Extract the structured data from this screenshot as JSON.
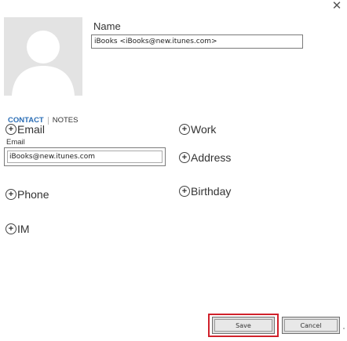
{
  "window": {
    "close_glyph": "✕"
  },
  "contact": {
    "name_label": "Name",
    "name_value": "iBooks <iBooks@new.itunes.com>"
  },
  "tabs": {
    "contact": "CONTACT",
    "notes": "NOTES"
  },
  "fields": {
    "email": {
      "label": "Email",
      "sub_label": "Email",
      "value": "iBooks@new.itunes.com"
    },
    "work": {
      "label": "Work"
    },
    "address": {
      "label": "Address"
    },
    "phone": {
      "label": "Phone"
    },
    "birthday": {
      "label": "Birthday"
    },
    "im": {
      "label": "IM"
    }
  },
  "plus_glyph": "+",
  "buttons": {
    "save": "Save",
    "cancel": "Cancel"
  },
  "colors": {
    "tab_active": "#2a6db5",
    "highlight": "#d0212b",
    "avatar_bg": "#e3e3e3"
  }
}
